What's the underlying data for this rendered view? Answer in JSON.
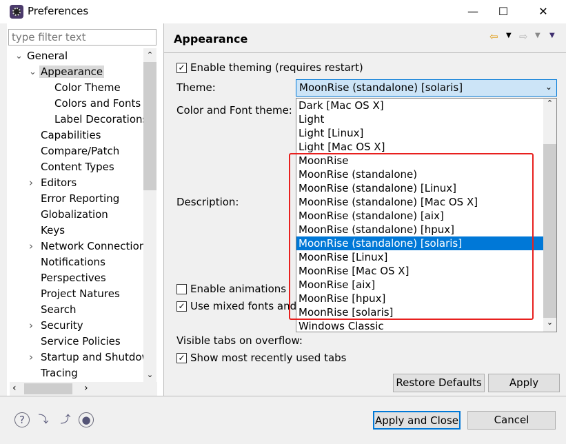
{
  "window": {
    "title": "Preferences",
    "minimize": "—",
    "maximize": "☐",
    "close": "✕"
  },
  "sidebar": {
    "filter_placeholder": "type filter text",
    "items": [
      {
        "label": "General",
        "level": 0,
        "twisty": "expanded"
      },
      {
        "label": "Appearance",
        "level": 1,
        "twisty": "expanded",
        "selected": true
      },
      {
        "label": "Color Theme",
        "level": 2
      },
      {
        "label": "Colors and Fonts",
        "level": 2
      },
      {
        "label": "Label Decorations",
        "level": 2
      },
      {
        "label": "Capabilities",
        "level": 1
      },
      {
        "label": "Compare/Patch",
        "level": 1
      },
      {
        "label": "Content Types",
        "level": 1
      },
      {
        "label": "Editors",
        "level": 1,
        "twisty": "collapsed"
      },
      {
        "label": "Error Reporting",
        "level": 1
      },
      {
        "label": "Globalization",
        "level": 1
      },
      {
        "label": "Keys",
        "level": 1
      },
      {
        "label": "Network Connection",
        "level": 1,
        "twisty": "collapsed"
      },
      {
        "label": "Notifications",
        "level": 1
      },
      {
        "label": "Perspectives",
        "level": 1
      },
      {
        "label": "Project Natures",
        "level": 1
      },
      {
        "label": "Search",
        "level": 1
      },
      {
        "label": "Security",
        "level": 1,
        "twisty": "collapsed"
      },
      {
        "label": "Service Policies",
        "level": 1
      },
      {
        "label": "Startup and Shutdow",
        "level": 1,
        "twisty": "collapsed"
      },
      {
        "label": "Tracing",
        "level": 1
      }
    ]
  },
  "page": {
    "title": "Appearance",
    "enable_theming": {
      "label": "Enable theming (requires restart)",
      "checked": true
    },
    "theme_label": "Theme:",
    "theme_value": "MoonRise (standalone) [solaris]",
    "color_font_label": "Color and Font theme:",
    "description_label": "Description:",
    "enable_animations": {
      "label": "Enable animations",
      "checked": false
    },
    "mixed_fonts": {
      "label": "Use mixed fonts and",
      "checked": true
    },
    "visible_tabs_label": "Visible tabs on overflow:",
    "show_recent": {
      "label": "Show most recently used tabs",
      "checked": true
    },
    "restore_defaults": "Restore Defaults",
    "apply": "Apply"
  },
  "theme_options": [
    "Dark [Mac OS X]",
    "Light",
    "Light [Linux]",
    "Light [Mac OS X]",
    "MoonRise",
    "MoonRise (standalone)",
    "MoonRise (standalone) [Linux]",
    "MoonRise (standalone) [Mac OS X]",
    "MoonRise (standalone) [aix]",
    "MoonRise (standalone) [hpux]",
    "MoonRise (standalone) [solaris]",
    "MoonRise [Linux]",
    "MoonRise [Mac OS X]",
    "MoonRise [aix]",
    "MoonRise [hpux]",
    "MoonRise [solaris]",
    "Windows Classic"
  ],
  "selected_option": "MoonRise (standalone) [solaris]",
  "footer": {
    "apply_close": "Apply and Close",
    "cancel": "Cancel"
  },
  "colors": {
    "accent": "#0078d7",
    "highlight_box": "#e8201e"
  }
}
